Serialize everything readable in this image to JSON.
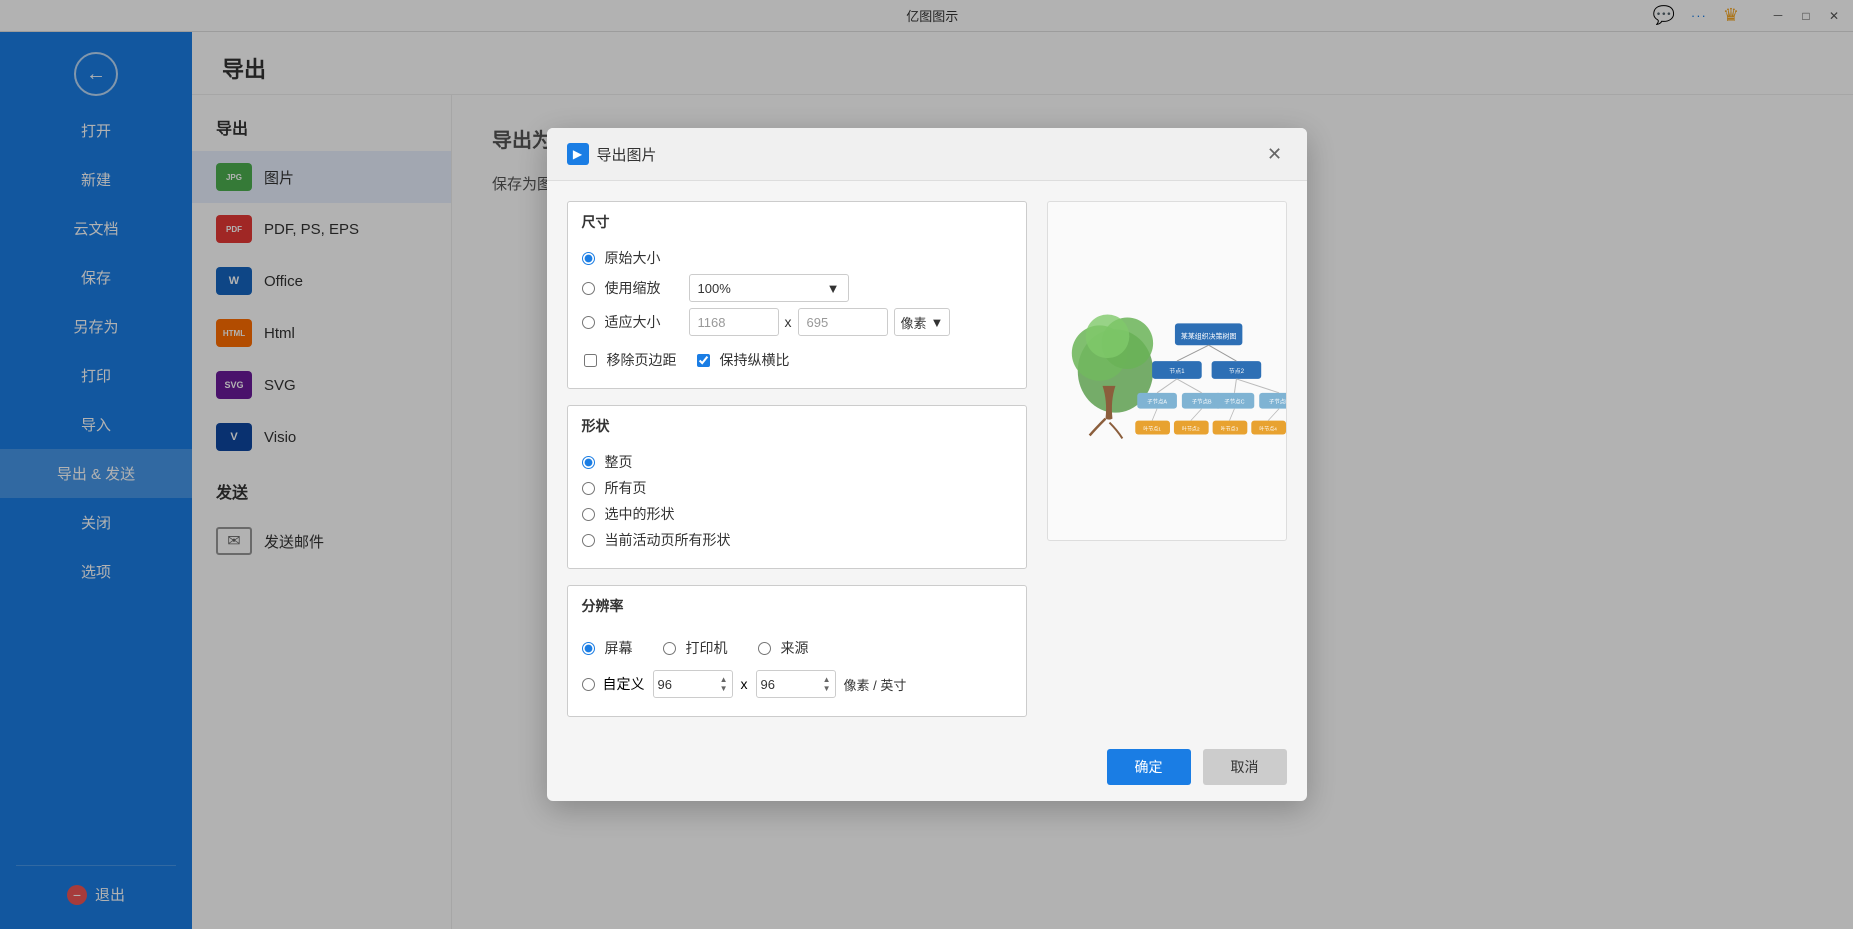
{
  "app": {
    "title": "亿图图示",
    "window_controls": {
      "minimize": "－",
      "maximize": "□",
      "close": "✕"
    }
  },
  "titlebar_right": {
    "chat_icon": "💬",
    "more_icon": "···",
    "crown_icon": "♛"
  },
  "sidebar": {
    "back_button": "←",
    "items": [
      {
        "id": "open",
        "label": "打开"
      },
      {
        "id": "new",
        "label": "新建"
      },
      {
        "id": "cloud",
        "label": "云文档"
      },
      {
        "id": "save",
        "label": "保存"
      },
      {
        "id": "save-as",
        "label": "另存为"
      },
      {
        "id": "print",
        "label": "打印"
      },
      {
        "id": "import",
        "label": "导入"
      },
      {
        "id": "export",
        "label": "导出 & 发送",
        "active": true
      },
      {
        "id": "close",
        "label": "关闭"
      },
      {
        "id": "options",
        "label": "选项"
      }
    ],
    "exit": {
      "label": "退出",
      "icon": "−"
    }
  },
  "export_panel": {
    "title": "导出",
    "export_section": "导出",
    "send_section": "发送",
    "types": [
      {
        "id": "image",
        "label": "图片",
        "badge": "JPG",
        "badge_type": "jpg",
        "active": true
      },
      {
        "id": "pdf",
        "label": "PDF, PS, EPS",
        "badge": "PDF",
        "badge_type": "pdf"
      },
      {
        "id": "office",
        "label": "Office",
        "badge": "W",
        "badge_type": "office"
      },
      {
        "id": "html",
        "label": "Html",
        "badge": "HTML",
        "badge_type": "html"
      },
      {
        "id": "svg",
        "label": "SVG",
        "badge": "SVG",
        "badge_type": "svg"
      },
      {
        "id": "visio",
        "label": "Visio",
        "badge": "V",
        "badge_type": "visio"
      }
    ],
    "send_types": [
      {
        "id": "email",
        "label": "发送邮件"
      }
    ],
    "description": "保存为图片文件，比如BMP, JPEG, PNG, GIF格式。"
  },
  "main_title": "导出为图像",
  "dialog": {
    "title": "导出图片",
    "title_icon": "▶",
    "close_icon": "✕",
    "size_section": {
      "label": "尺寸",
      "options": [
        {
          "id": "original",
          "label": "原始大小",
          "checked": true
        },
        {
          "id": "zoom",
          "label": "使用缩放",
          "checked": false
        },
        {
          "id": "adapt",
          "label": "适应大小",
          "checked": false
        }
      ],
      "zoom_value": "100%",
      "zoom_placeholder": "100%",
      "width_value": "1168",
      "height_value": "695",
      "unit": "像素",
      "unit_arrow": "▼",
      "x_label": "x",
      "remove_margin": "移除页边距",
      "keep_ratio": "保持纵横比",
      "remove_margin_checked": false,
      "keep_ratio_checked": true
    },
    "shape_section": {
      "label": "形状",
      "options": [
        {
          "id": "whole-page",
          "label": "整页",
          "checked": true
        },
        {
          "id": "all-pages",
          "label": "所有页",
          "checked": false
        },
        {
          "id": "selected",
          "label": "选中的形状",
          "checked": false
        },
        {
          "id": "active-shapes",
          "label": "当前活动页所有形状",
          "checked": false
        }
      ]
    },
    "resolution_section": {
      "label": "分辨率",
      "options": [
        {
          "id": "screen",
          "label": "屏幕",
          "checked": true
        },
        {
          "id": "printer",
          "label": "打印机",
          "checked": false
        },
        {
          "id": "source",
          "label": "来源",
          "checked": false
        }
      ],
      "custom": {
        "label": "自定义",
        "checked": false,
        "width": "96",
        "height": "96",
        "unit": "像素 / 英寸"
      }
    },
    "buttons": {
      "confirm": "确定",
      "cancel": "取消"
    }
  }
}
